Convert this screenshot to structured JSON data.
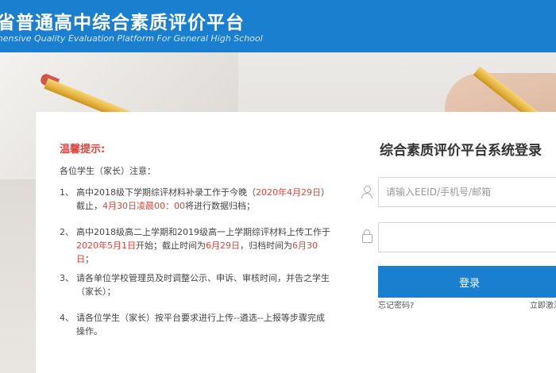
{
  "header": {
    "title": "省普通高中综合素质评价平台",
    "subtitle": "ehensive Quality Evaluation Platform For General High School"
  },
  "notice": {
    "title": "温馨提示:",
    "greeting": "各位学生（家长）注意：",
    "items": [
      {
        "num": "1、",
        "parts": [
          {
            "text": "高中2018级下学期综评材料补录工作于今晚（",
            "red": false
          },
          {
            "text": "2020年4月29日",
            "red": true
          },
          {
            "text": "）截止，",
            "red": false
          },
          {
            "text": "4月30日凌晨00：00",
            "red": true
          },
          {
            "text": "将进行数据归档；",
            "red": false
          }
        ]
      },
      {
        "num": "2、",
        "parts": [
          {
            "text": "高中2018级高二上学期和2019级高一上学期综评材料上传工作于",
            "red": false
          },
          {
            "text": "2020年5月1日",
            "red": true
          },
          {
            "text": "开始；截止时间为",
            "red": false
          },
          {
            "text": "6月29日",
            "red": true
          },
          {
            "text": "，归档时间为",
            "red": false
          },
          {
            "text": "6月30日",
            "red": true
          },
          {
            "text": "；",
            "red": false
          }
        ]
      },
      {
        "num": "3、",
        "parts": [
          {
            "text": "请各单位学校管理员及时调整公示、申诉、审核时间，并告之学生（家长）；",
            "red": false
          }
        ]
      },
      {
        "num": "4、",
        "parts": [
          {
            "text": "请各位学生（家长）按平台要求进行上传--遴选--上报等步骤完成操作。",
            "red": false
          }
        ]
      }
    ]
  },
  "login": {
    "title": "综合素质评价平台系统登录",
    "account_placeholder": "请输入EEID/手机号/邮箱",
    "password_value": "",
    "button_label": "登录",
    "forgot_label": "忘记密码?",
    "activate_label": "立即激活"
  },
  "icons": {
    "user": "user-icon",
    "lock": "lock-icon"
  },
  "colors": {
    "brand_blue": "#1a7fcf",
    "notice_red": "#e2423d"
  }
}
